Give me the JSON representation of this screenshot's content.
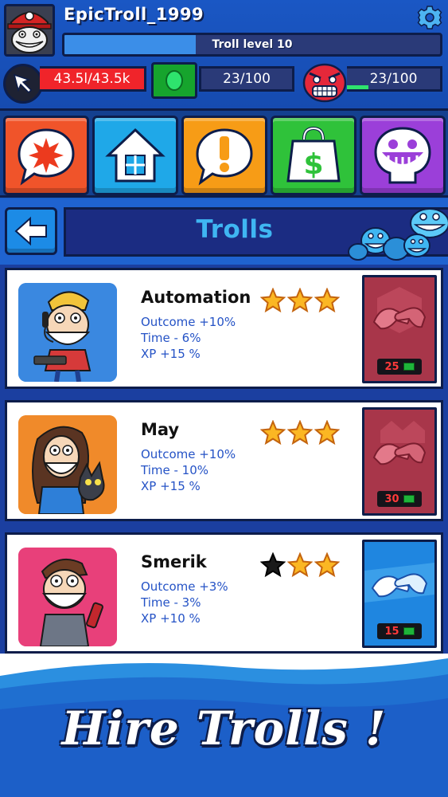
{
  "header": {
    "username": "EpicTroll_1999",
    "level_label": "Troll level 10",
    "level_progress": 0.35,
    "cash": "43.5l/43.5k",
    "gems": "23/100",
    "rage": "23/100",
    "rage_progress": 0.23
  },
  "categories": [
    {
      "name": "category-pranks",
      "icon": "explosion-bubble-icon",
      "color": "#f0542a"
    },
    {
      "name": "category-home",
      "icon": "house-icon",
      "color": "#1fa8e8"
    },
    {
      "name": "category-alerts",
      "icon": "exclamation-bubble-icon",
      "color": "#f79c16"
    },
    {
      "name": "category-shop",
      "icon": "money-bag-icon",
      "color": "#2fc23a"
    },
    {
      "name": "category-trolls",
      "icon": "troll-face-icon",
      "color": "#9b3fd9"
    }
  ],
  "page": {
    "title": "Trolls"
  },
  "trolls": [
    {
      "name": "Automation",
      "outcome": "Outcome +10%",
      "time": "Time - 6%",
      "xp": "XP +15 %",
      "stars_filled": 3,
      "cost": "25",
      "card_style": "locked",
      "portrait_bg": "#3a88e0"
    },
    {
      "name": "May",
      "outcome": "Outcome +10%",
      "time": "Time - 10%",
      "xp": "XP +15 %",
      "stars_filled": 3,
      "cost": "30",
      "card_style": "locked",
      "portrait_bg": "#f08a2a"
    },
    {
      "name": "Smerik",
      "outcome": "Outcome +3%",
      "time": "Time - 3%",
      "xp": "XP +10 %",
      "stars_filled": 2,
      "cost": "15",
      "card_style": "available",
      "portrait_bg": "#e8407a"
    }
  ],
  "banner": {
    "text": "Hire Trolls !"
  }
}
